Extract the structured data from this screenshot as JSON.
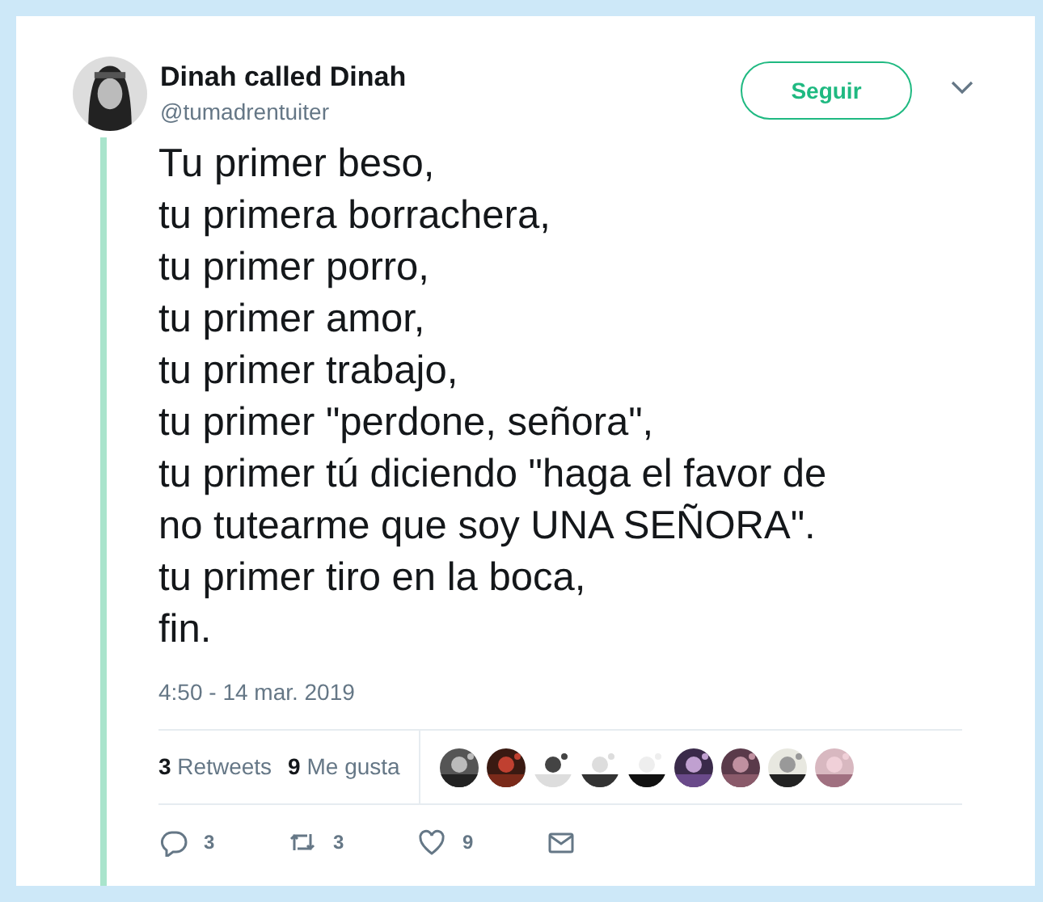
{
  "author": {
    "name": "Dinah called Dinah",
    "handle": "@tumadrentuiter"
  },
  "follow_button": "Seguir",
  "tweet_lines": [
    "Tu primer beso,",
    "tu primera borrachera,",
    "tu primer porro,",
    "tu primer amor,",
    "tu primer trabajo,",
    "tu primer \"perdone, señora\",",
    "tu primer tú diciendo \"haga el favor de",
    "no tutearme que soy UNA SEÑORA\".",
    "tu primer tiro en la boca,",
    "fin."
  ],
  "timestamp": "4:50 - 14 mar. 2019",
  "stats": [
    {
      "count": "3",
      "label": "Retweets"
    },
    {
      "count": "9",
      "label": "Me gusta"
    }
  ],
  "actions": [
    {
      "kind": "reply",
      "count": "3"
    },
    {
      "kind": "retweet",
      "count": "3"
    },
    {
      "kind": "like",
      "count": "9"
    },
    {
      "kind": "message"
    }
  ]
}
